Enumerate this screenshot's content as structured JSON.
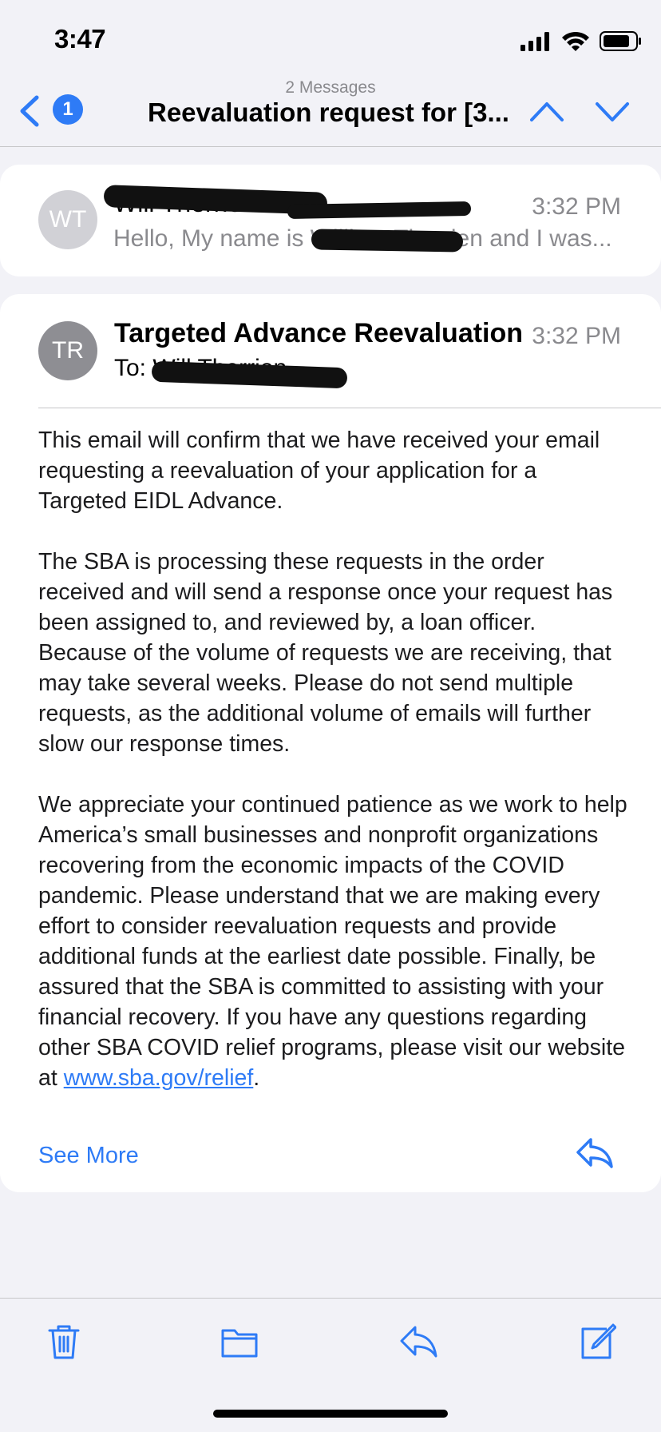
{
  "status_bar": {
    "time": "3:47"
  },
  "nav": {
    "unread_count": "1",
    "subtitle": "2 Messages",
    "title": "Reevaluation request for [3..."
  },
  "messages": [
    {
      "initials": "WT",
      "sender": "Will Therrien",
      "time": "3:32 PM",
      "preview": "Hello, My name is William Therrien and I was..."
    },
    {
      "initials": "TR",
      "sender": "Targeted Advance Reevaluation",
      "time": "3:32 PM",
      "to_label": "To:",
      "to_value": "Will Therrien",
      "body": {
        "p1": "This email will confirm that we have received your email requesting a reevaluation of your application for a Targeted EIDL Advance.",
        "p2": "The SBA is processing these requests in the order received and will send a response once your request has been assigned to, and reviewed by, a loan officer. Because of the volume of requests we are receiving, that may take several weeks. Please do not send multiple requests, as the additional volume of emails will further slow our response times.",
        "p3": "We appreciate your continued patience as we work to help America’s small businesses and nonprofit organizations recovering from the economic impacts of the COVID pandemic. Please understand that we are making every effort to consider reevaluation requests and provide additional funds at the earliest date possible. Finally, be assured that the SBA is committed to assisting with your financial recovery. If you have any questions regarding other SBA COVID relief programs, please visit our website at ",
        "link": "www.sba.gov/relief",
        "p3_end": "."
      },
      "see_more": "See More"
    }
  ],
  "toolbar": {
    "icons": [
      "trash-icon",
      "folder-icon",
      "reply-icon",
      "compose-icon"
    ]
  },
  "colors": {
    "accent": "#2e7bf6",
    "secondary_text": "#8a8a8e",
    "background": "#f2f2f7"
  }
}
